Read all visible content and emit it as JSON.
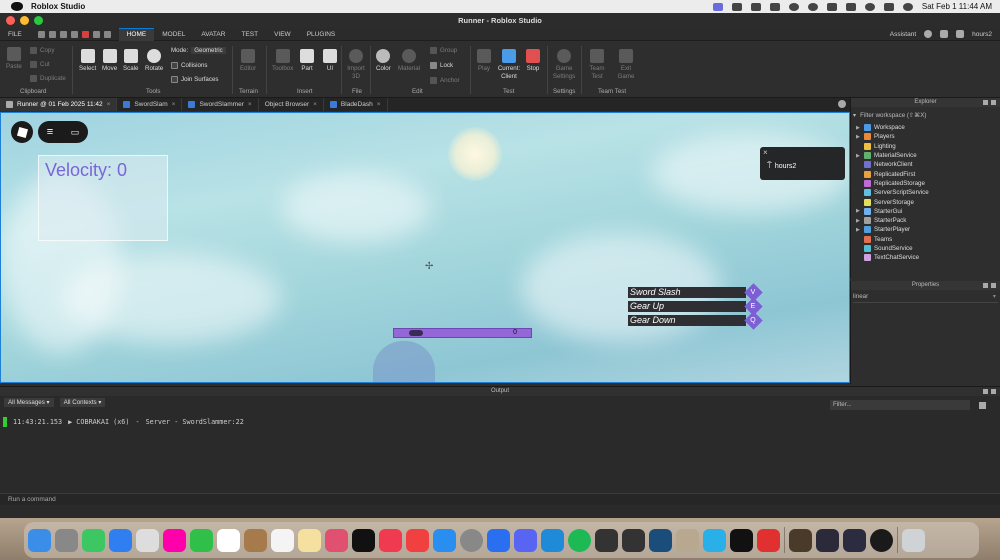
{
  "menubar": {
    "app": "Roblox Studio",
    "clock": "Sat Feb 1  11:44 AM"
  },
  "window": {
    "title": "Runner - Roblox Studio"
  },
  "ribbon_tabs": [
    "FILE",
    "HOME",
    "MODEL",
    "AVATAR",
    "TEST",
    "VIEW",
    "PLUGINS"
  ],
  "account": {
    "assistant": "Assistant",
    "user": "hours2"
  },
  "ribbon": {
    "paste": "Paste",
    "copy": "Copy",
    "cut": "Cut",
    "duplicate": "Duplicate",
    "clipboard": "Clipboard",
    "select": "Select",
    "move": "Move",
    "scale": "Scale",
    "rotate": "Rotate",
    "mode_label": "Mode:",
    "mode_value": "Geometric",
    "collisions": "Collisions",
    "join_surfaces": "Join Surfaces",
    "tools": "Tools",
    "editor": "Editor",
    "terrain": "Terrain",
    "toolbox": "Toolbox",
    "part": "Part",
    "ui": "UI",
    "insert": "Insert",
    "import3d": "Import 3D",
    "file": "File",
    "color": "Color",
    "material": "Material",
    "group": "Group",
    "lock": "Lock",
    "anchor": "Anchor",
    "edit": "Edit",
    "play": "Play",
    "current_client": "Current: Client",
    "stop": "Stop",
    "test": "Test",
    "game_settings": "Game Settings",
    "settings": "Settings",
    "team_test": "Team Test",
    "exit_game": "Exit Game",
    "team_test_group": "Team Test"
  },
  "doc_tabs": [
    "Runner @ 01 Feb 2025 11:42",
    "SwordSlam",
    "SwordSlammer",
    "Object Browser",
    "BladeDash"
  ],
  "game": {
    "velocity": "Velocity: 0",
    "notif_user": "hours2",
    "skills": [
      {
        "name": "Sword Slash",
        "key": "V"
      },
      {
        "name": "Gear Up",
        "key": "E"
      },
      {
        "name": "Gear Down",
        "key": "Q"
      }
    ],
    "bar_value": "0",
    "bar_level": 0,
    "accent": "#7d5fd4"
  },
  "explorer": {
    "title": "Explorer",
    "filter": "Filter workspace (⇧⌘X)",
    "items": [
      "Workspace",
      "Players",
      "Lighting",
      "MaterialService",
      "NetworkClient",
      "ReplicatedFirst",
      "ReplicatedStorage",
      "ServerScriptService",
      "ServerStorage",
      "StarterGui",
      "StarterPack",
      "StarterPlayer",
      "Teams",
      "SoundService",
      "TextChatService"
    ]
  },
  "properties": {
    "title": "Properties",
    "filter": "linear"
  },
  "output": {
    "title": "Output",
    "filter_messages": "All Messages",
    "filter_contexts": "All Contexts",
    "filter_placeholder": "Filter...",
    "line": {
      "time": "11:43:21.153",
      "source": "▶ COBRAKAI (x6)",
      "sep": "-",
      "context": "Server - SwordSlammer:22"
    }
  },
  "command": {
    "placeholder": "Run a command"
  }
}
